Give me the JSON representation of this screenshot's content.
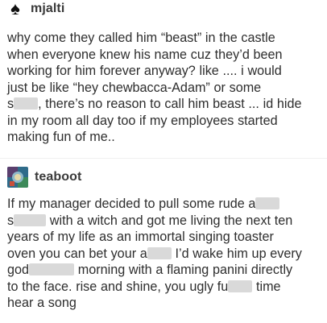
{
  "post1": {
    "username": "mjalti",
    "lines": [
      "why come they called him “beast” in the castle",
      "when everyone knew his name cuz they’d been",
      "working for him forever anyway? like .... i would",
      "just be like “hey chewbacca-Adam” or some",
      ", there’s no reason to call him beast ... id hide",
      "in my room all day too if my employees started",
      "making fun of me.."
    ],
    "line5_prefix": "s"
  },
  "post2": {
    "username": "teaboot",
    "line1": "If my manager decided to pull some rude a",
    "line2_pre": "s",
    "line2_post": "with a witch and got me living the next ten",
    "line3": "years of my life as an immortal singing toaster",
    "line4_pre": "oven you can bet your a",
    "line4_post": "I’d wake him up every",
    "line5_pre": "god",
    "line5_post": "morning with a flaming panini directly",
    "line6": "to the face. rise and shine, you ugly fu",
    "line6_post": "time",
    "line7": "hear a song"
  },
  "icons": {
    "post1_avatar": "spade-icon",
    "post2_avatar": "teaboot-avatar"
  }
}
